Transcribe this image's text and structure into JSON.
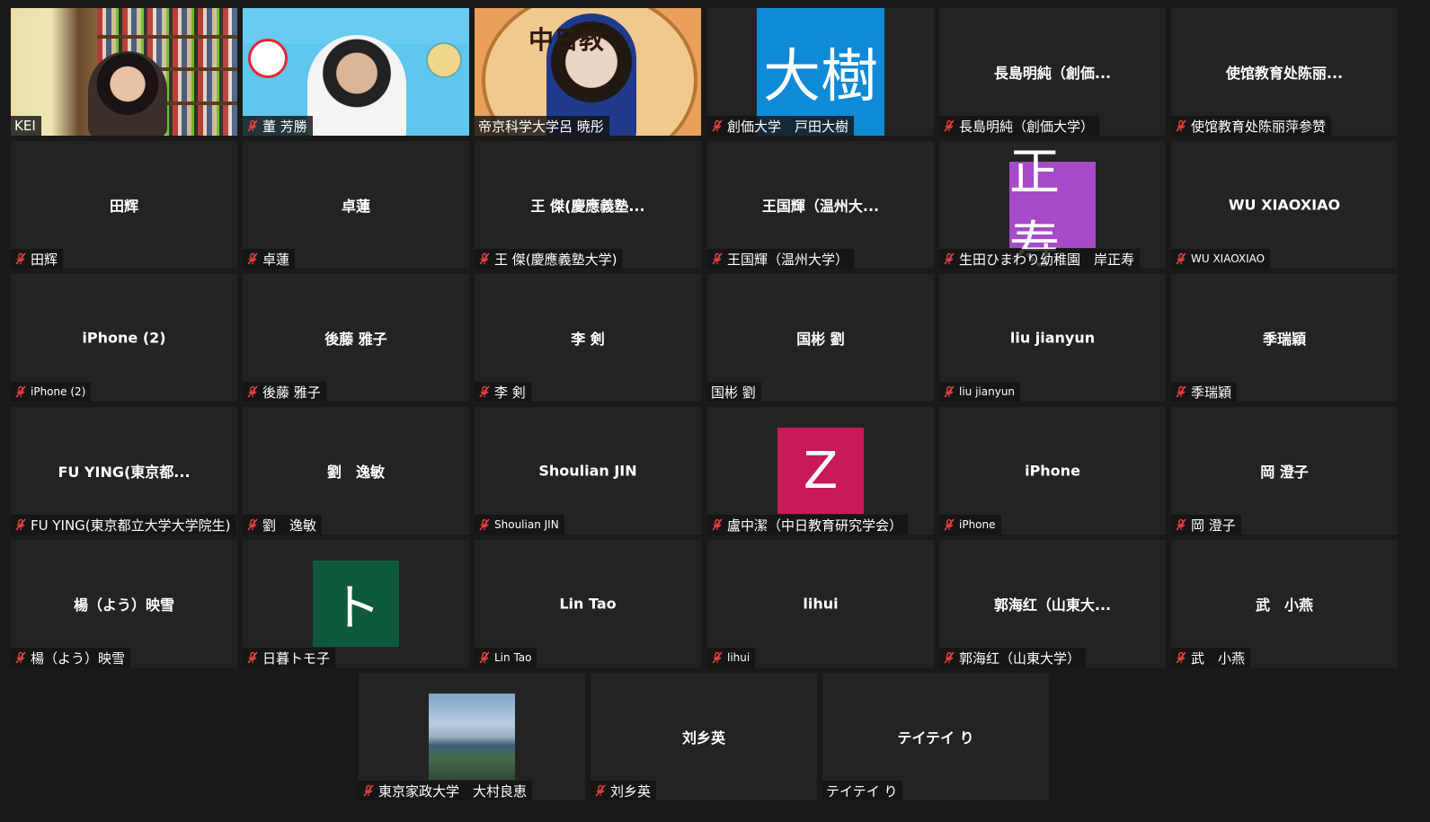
{
  "colors": {
    "background": "#1a1a1a",
    "tile": "#232323",
    "active_speaker_border": "#e3e86b",
    "mute_icon": "#e8413c",
    "avatar_daiki": "#0f8ad6",
    "avatar_masatoshi": "#a64ac9",
    "avatar_z": "#c8195a",
    "avatar_to": "#0f5a3a"
  },
  "tiles": [
    {
      "type": "video",
      "variant": "v1",
      "label": "KEI",
      "muted": false
    },
    {
      "type": "video",
      "variant": "v2",
      "label": "董 芳勝",
      "muted": true
    },
    {
      "type": "video",
      "variant": "v3",
      "label": "帝京科学大学呂 暁彤",
      "muted": false,
      "speaking": true,
      "video_text": "中日教"
    },
    {
      "type": "avatar",
      "avatar_text": "大樹",
      "avatar_color": "#0f8ad6",
      "avatar_size": "big",
      "label": "創価大学　戸田大樹",
      "muted": true
    },
    {
      "type": "name",
      "name": "長島明純（創価...",
      "label": "長島明純（創価大学）",
      "muted": true
    },
    {
      "type": "name",
      "name": "使馆教育处陈丽...",
      "label": "使馆教育处陈丽萍参赞",
      "muted": true
    },
    {
      "type": "name",
      "name": "田辉",
      "label": "田辉",
      "muted": true
    },
    {
      "type": "name",
      "name": "卓蓮",
      "label": "卓蓮",
      "muted": true
    },
    {
      "type": "name",
      "name": "王 傑(慶應義塾...",
      "label": "王 傑(慶應義塾大学)",
      "muted": true
    },
    {
      "type": "name",
      "name": "王国輝（温州大...",
      "label": "王国輝（温州大学）",
      "muted": true
    },
    {
      "type": "avatar",
      "avatar_text": "正寿",
      "avatar_color": "#a64ac9",
      "label": "生田ひまわり幼稚園　岸正寿",
      "muted": true
    },
    {
      "type": "name",
      "name": "WU XIAOXIAO",
      "label": "WU XIAOXIAO",
      "muted": true,
      "small": true
    },
    {
      "type": "name",
      "name": "iPhone (2)",
      "label": "iPhone (2)",
      "muted": true,
      "small": true
    },
    {
      "type": "name",
      "name": "後藤 雅子",
      "label": "後藤 雅子",
      "muted": true
    },
    {
      "type": "name",
      "name": "李 剣",
      "label": "李 剣",
      "muted": true
    },
    {
      "type": "name",
      "name": "国彬 劉",
      "label": "国彬 劉",
      "muted": false
    },
    {
      "type": "name",
      "name": "liu jianyun",
      "label": "liu jianyun",
      "muted": true,
      "small": true
    },
    {
      "type": "name",
      "name": "季瑞穎",
      "label": "季瑞穎",
      "muted": true
    },
    {
      "type": "name",
      "name": "FU YING(東京都...",
      "label": "FU YING(東京都立大学大学院生)",
      "muted": true
    },
    {
      "type": "name",
      "name": "劉　逸敏",
      "label": "劉　逸敏",
      "muted": true
    },
    {
      "type": "name",
      "name": "Shoulian JIN",
      "label": "Shoulian JIN",
      "muted": true,
      "small": true
    },
    {
      "type": "avatar",
      "avatar_text": "Z",
      "avatar_color": "#c8195a",
      "label": "盧中潔（中日教育研究学会）",
      "muted": true
    },
    {
      "type": "name",
      "name": "iPhone",
      "label": "iPhone",
      "muted": true,
      "small": true
    },
    {
      "type": "name",
      "name": "岡 澄子",
      "label": "岡 澄子",
      "muted": true
    },
    {
      "type": "name",
      "name": "楊（よう）映雪",
      "label": "楊（よう）映雪",
      "muted": true
    },
    {
      "type": "avatar",
      "avatar_text": "ト",
      "avatar_color": "#0f5a3a",
      "label": "日暮トモ子",
      "muted": true
    },
    {
      "type": "name",
      "name": "Lin Tao",
      "label": "Lin Tao",
      "muted": true,
      "small": true
    },
    {
      "type": "name",
      "name": "lihui",
      "label": "lihui",
      "muted": true,
      "small": true
    },
    {
      "type": "name",
      "name": "郭海红（山東大...",
      "label": "郭海红（山東大学）",
      "muted": true
    },
    {
      "type": "name",
      "name": "武　小燕",
      "label": "武　小燕",
      "muted": true
    },
    {
      "type": "avatar",
      "avatar_text": "",
      "avatar_color": "landscape",
      "label": "東京家政大学　大村良恵",
      "muted": true
    },
    {
      "type": "name",
      "name": "刘乡英",
      "label": "刘乡英",
      "muted": true
    },
    {
      "type": "name",
      "name": "テイテイ り",
      "label": "テイテイ り",
      "muted": false
    }
  ]
}
